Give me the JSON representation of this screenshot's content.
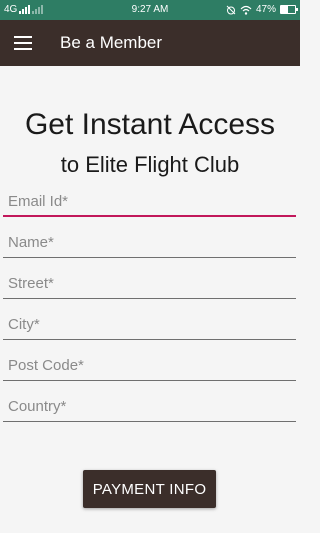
{
  "status_bar": {
    "network": "4G",
    "time": "9:27 AM",
    "battery": "47%",
    "battery_level": 0.47,
    "icons": [
      "signal-icon",
      "signal-weak-icon",
      "alarm-off-icon",
      "wifi-icon",
      "battery-icon"
    ]
  },
  "app_bar": {
    "title": "Be a Member",
    "menu_icon": "hamburger-menu-icon"
  },
  "headline": {
    "line1": "Get Instant Access",
    "line2": "to Elite Flight Club"
  },
  "form": {
    "email_placeholder": "Email Id*",
    "name_placeholder": "Name*",
    "street_placeholder": "Street*",
    "city_placeholder": "City*",
    "postcode_placeholder": "Post Code*",
    "country_placeholder": "Country*"
  },
  "button": {
    "label": "PAYMENT INFO"
  },
  "colors": {
    "status_bar": "#2e7d64",
    "app_bar": "#3b2e2a",
    "focus_underline": "#c2185b",
    "background": "#f5f5f5"
  }
}
